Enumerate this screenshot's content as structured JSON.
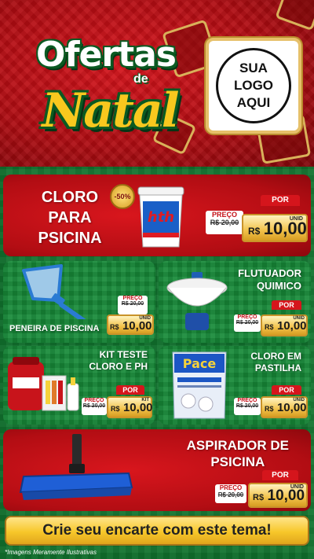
{
  "header": {
    "title_top": "Ofertas",
    "title_de": "de",
    "title_main": "Natal",
    "logo_line1": "SUA",
    "logo_line2": "LOGO",
    "logo_line3": "AQUI"
  },
  "products": [
    {
      "name_l1": "CLORO",
      "name_l2": "PARA",
      "name_l3": "PSICINA",
      "badge": "-50%",
      "brand": "hth",
      "old_label": "PREÇO",
      "old_price": "R$ 20,00",
      "por": "POR",
      "rs": "R$",
      "price": "10,00",
      "unit": "UNID"
    },
    {
      "name": "PENEIRA DE PISCINA",
      "old_label": "PREÇO",
      "old_price": "R$ 20,00",
      "rs": "R$",
      "price": "10,00",
      "unit": "UNID"
    },
    {
      "name_l1": "FLUTUADOR",
      "name_l2": "QUIMICO",
      "old_label": "PREÇO",
      "old_price": "R$ 20,00",
      "por": "POR",
      "rs": "R$",
      "price": "10,00",
      "unit": "UNID"
    },
    {
      "name_l1": "KIT TESTE",
      "name_l2": "CLORO E PH",
      "old_label": "PREÇO",
      "old_price": "R$ 20,00",
      "por": "POR",
      "rs": "R$",
      "price": "10,00",
      "unit": "KIT"
    },
    {
      "name_l1": "CLORO EM",
      "name_l2": "PASTILHA",
      "brand": "Pace",
      "old_label": "PREÇO",
      "old_price": "R$ 20,00",
      "por": "POR",
      "rs": "R$",
      "price": "10,00",
      "unit": "UNID"
    },
    {
      "name_l1": "ASPIRADOR DE",
      "name_l2": "PSICINA",
      "old_label": "PREÇO",
      "old_price": "R$ 20,00",
      "por": "POR",
      "rs": "R$",
      "price": "10,00",
      "unit": "UNID"
    }
  ],
  "banner": "Crie seu encarte com este tema!",
  "disclaimer": "*Imagens Meramente Ilustrativas",
  "colors": {
    "red": "#c8121a",
    "green": "#168a38",
    "gold": "#f2c24a"
  }
}
